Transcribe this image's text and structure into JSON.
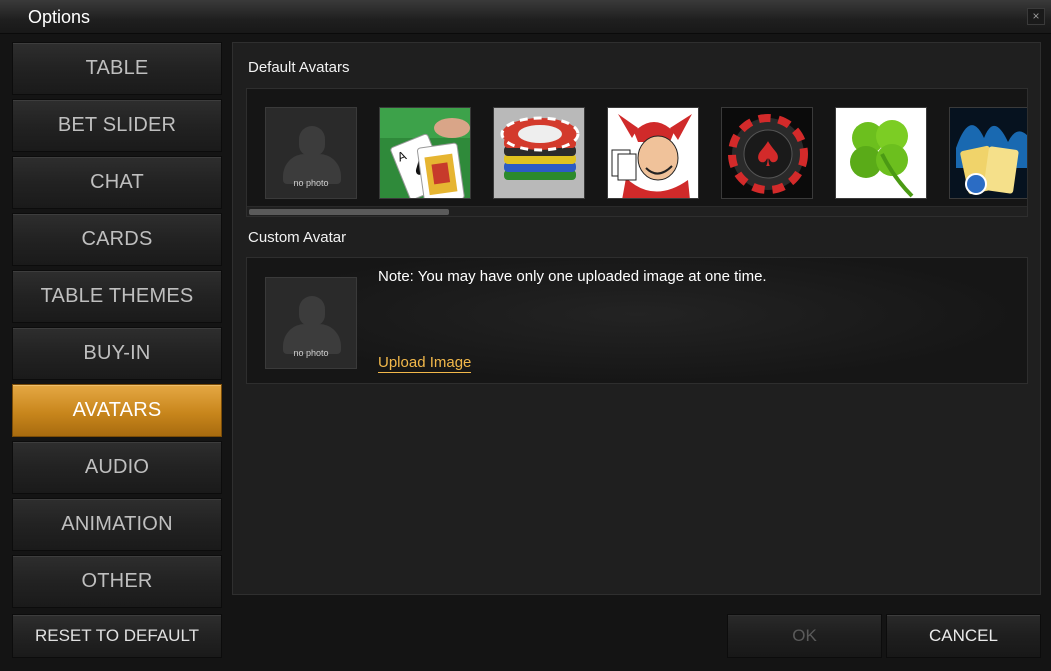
{
  "window": {
    "title": "Options",
    "close_glyph": "×"
  },
  "sidebar": {
    "items": [
      {
        "label": "TABLE",
        "active": false
      },
      {
        "label": "BET SLIDER",
        "active": false
      },
      {
        "label": "CHAT",
        "active": false
      },
      {
        "label": "CARDS",
        "active": false
      },
      {
        "label": "TABLE THEMES",
        "active": false
      },
      {
        "label": "BUY-IN",
        "active": false
      },
      {
        "label": "AVATARS",
        "active": true
      },
      {
        "label": "AUDIO",
        "active": false
      },
      {
        "label": "ANIMATION",
        "active": false
      },
      {
        "label": "OTHER",
        "active": false
      }
    ],
    "reset_label": "RESET TO DEFAULT"
  },
  "avatars": {
    "default_label": "Default Avatars",
    "items": [
      {
        "name": "no-photo",
        "caption": "no photo"
      },
      {
        "name": "cards-on-felt"
      },
      {
        "name": "chip-stack"
      },
      {
        "name": "joker"
      },
      {
        "name": "spade-chip"
      },
      {
        "name": "four-leaf-clover"
      },
      {
        "name": "aces-in-flames"
      }
    ],
    "scroll_position": 0.0
  },
  "custom": {
    "label": "Custom Avatar",
    "placeholder_caption": "no photo",
    "note": "Note: You may have only one uploaded image at one time.",
    "upload_label": "Upload Image"
  },
  "footer": {
    "ok_label": "OK",
    "ok_enabled": false,
    "cancel_label": "CANCEL"
  },
  "colors": {
    "accent": "#d6952e",
    "link": "#f2b84a",
    "background": "#1f1f1f"
  }
}
